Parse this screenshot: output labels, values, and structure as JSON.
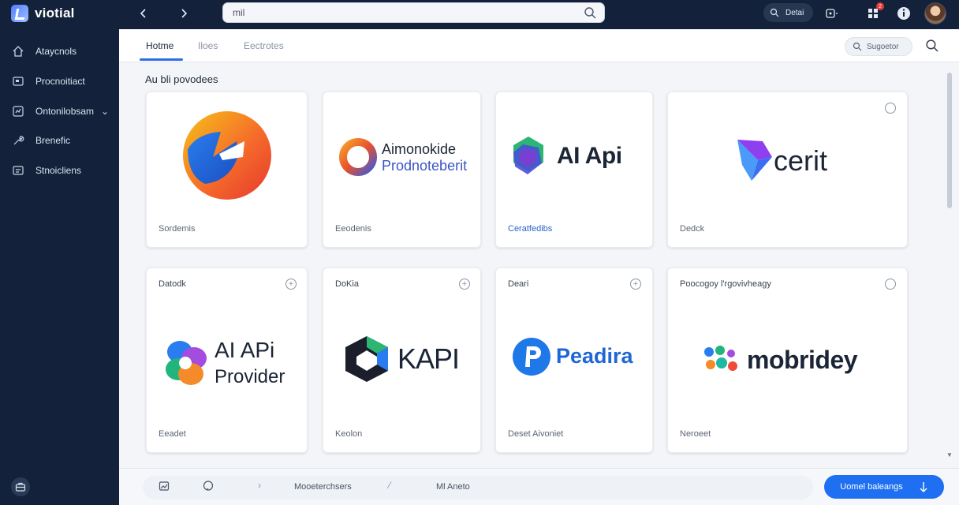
{
  "app": {
    "name": "viotial"
  },
  "sidebar": {
    "items": [
      {
        "label": "Ataycnols",
        "icon": "home-icon"
      },
      {
        "label": "Procnoitiact",
        "icon": "card-icon"
      },
      {
        "label": "Ontonilobsam",
        "icon": "chart-icon"
      },
      {
        "label": "Brenefic",
        "icon": "wrench-icon"
      },
      {
        "label": "Stnoicliens",
        "icon": "list-icon"
      }
    ],
    "bottom_icon": "briefcase-icon"
  },
  "topbar": {
    "search_value": "mil",
    "pill_label": "Detai",
    "notification_count": "2"
  },
  "tabs": [
    {
      "label": "Hotme",
      "active": true
    },
    {
      "label": "Iloes",
      "active": false
    },
    {
      "label": "Eectrotes",
      "active": false
    }
  ],
  "suggest_label": "Sugoetor",
  "section_title": "Au bli povodees",
  "cards": [
    {
      "logo_text": "",
      "label": "Sordemis",
      "logo": "swirl-v-logo"
    },
    {
      "logo_text": "Aimonokide",
      "logo_text2": "Prodnoteberit",
      "label": "Eeodenis",
      "logo": "ring-logo"
    },
    {
      "logo_text": "AI Api",
      "label": "Ceratfedibs",
      "logo": "hex-cluster-logo"
    },
    {
      "logo_text": "cerit",
      "label": "Dedck",
      "logo": "cube-logo"
    },
    {
      "top_label": "Datodk",
      "logo_text": "AI APi",
      "logo_text2": "Provider",
      "label": "Eeadet",
      "logo": "petal-logo"
    },
    {
      "top_label": "DoKia",
      "logo_text": "KAPI",
      "label": "Keolon",
      "logo": "hexagon-logo"
    },
    {
      "top_label": "Deari",
      "logo_text": "Peadira",
      "label": "Deset Aivoniet",
      "logo": "p-circle-logo"
    },
    {
      "top_label": "Poocogoy l'rgovivheagy",
      "logo_text": "mobridey",
      "label": "Neroeet",
      "logo": "dots-logo"
    }
  ],
  "bottombar": {
    "items": [
      "Mooeterchsers",
      "Ml Aneto"
    ],
    "button_label": "Uomel baleangs"
  }
}
